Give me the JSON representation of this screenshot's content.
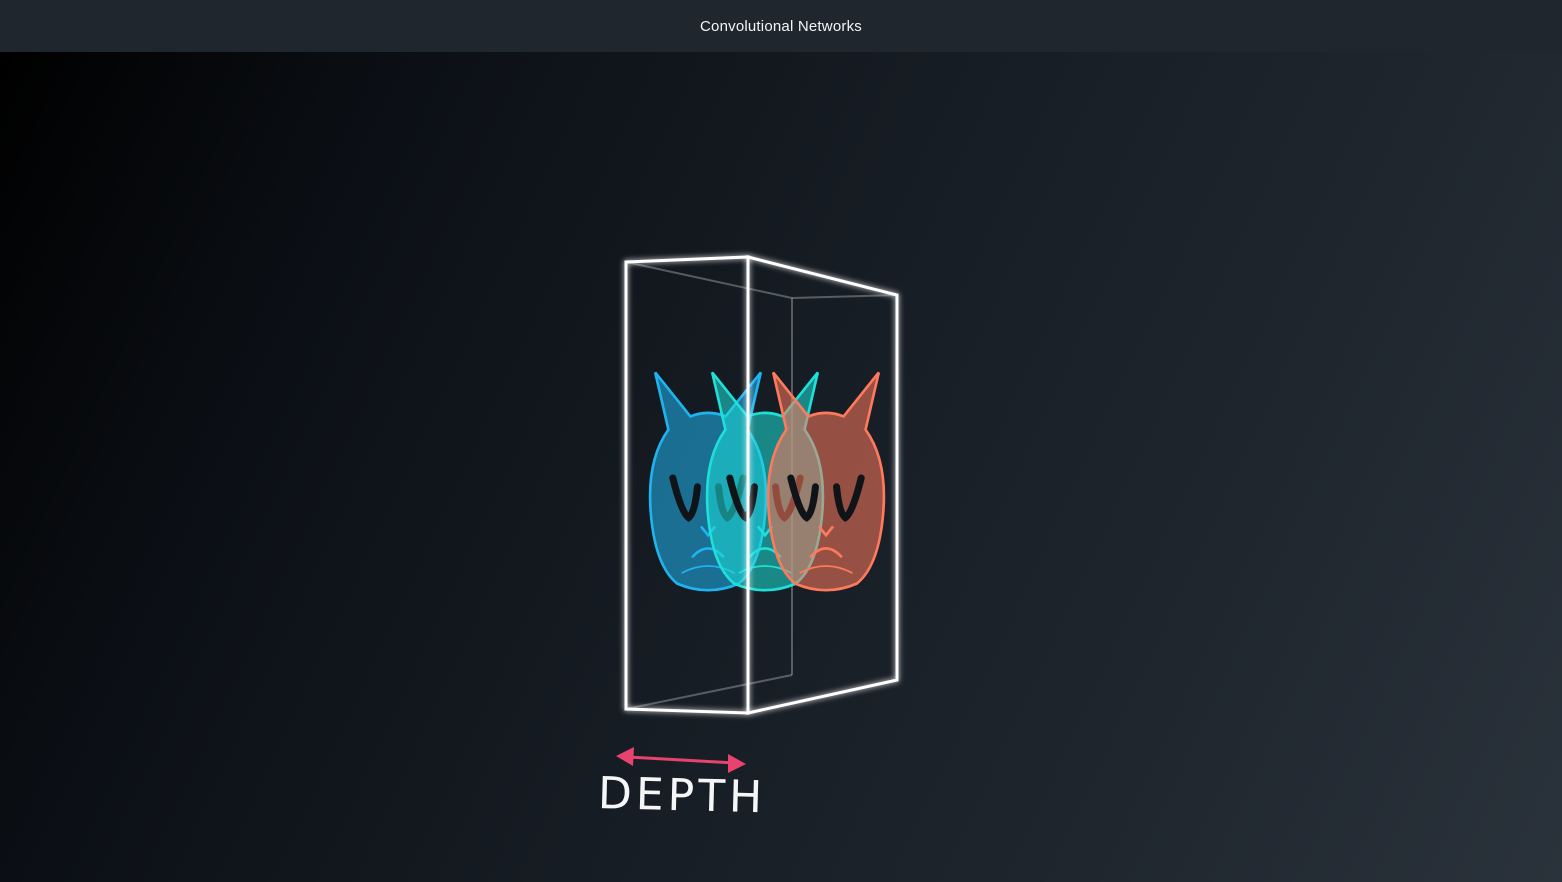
{
  "header": {
    "title": "Convolutional Networks"
  },
  "figure": {
    "label": "DEPTH",
    "colors": {
      "box_stroke": "#ffffff",
      "arrow": "#e8436e",
      "cat_blue": "#1fb4f0",
      "cat_cyan": "#1ee0d8",
      "cat_orange": "#ff7a5c"
    },
    "icons": [
      "cat-face-icon",
      "depth-arrow-icon",
      "3d-box-icon"
    ]
  }
}
